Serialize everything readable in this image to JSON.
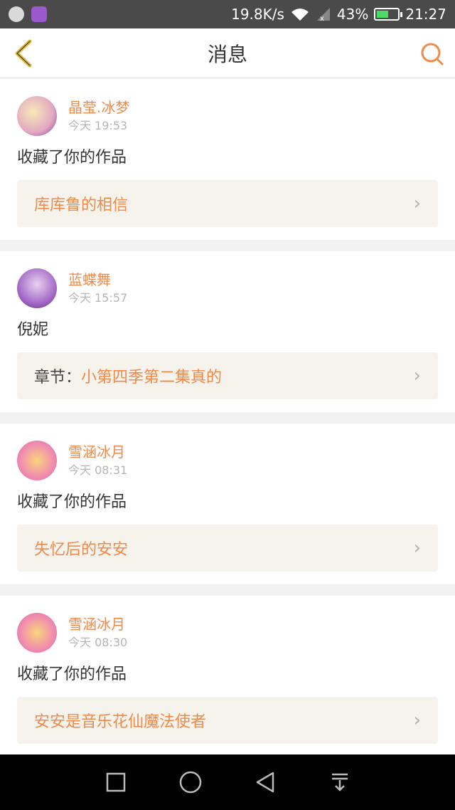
{
  "status_bar": {
    "speed": "19.8K/s",
    "battery": "43%",
    "time": "21:27"
  },
  "header": {
    "title": "消息"
  },
  "messages": [
    {
      "username": "晶莹.冰梦",
      "time": "今天 19:53",
      "action": "收藏了你的作品",
      "ref_prefix": "",
      "ref_title": "库库鲁的相信",
      "avatar_color": "#f0d8c8"
    },
    {
      "username": "蓝蝶舞",
      "time": "今天 15:57",
      "action": "倪妮",
      "ref_prefix": "章节：",
      "ref_title": "小第四季第二集真的",
      "avatar_color": "#b58ad0"
    },
    {
      "username": "雪涵冰月",
      "time": "今天 08:31",
      "action": "收藏了你的作品",
      "ref_prefix": "",
      "ref_title": "失忆后的安安",
      "avatar_color": "#f3b3c8"
    },
    {
      "username": "雪涵冰月",
      "time": "今天 08:30",
      "action": "收藏了你的作品",
      "ref_prefix": "",
      "ref_title": "安安是音乐花仙魔法使者",
      "avatar_color": "#f3b3c8"
    }
  ],
  "colors": {
    "accent": "#f08a4b",
    "back_arrow": "#e3b82f",
    "ref_bg": "#f5f3ec"
  }
}
